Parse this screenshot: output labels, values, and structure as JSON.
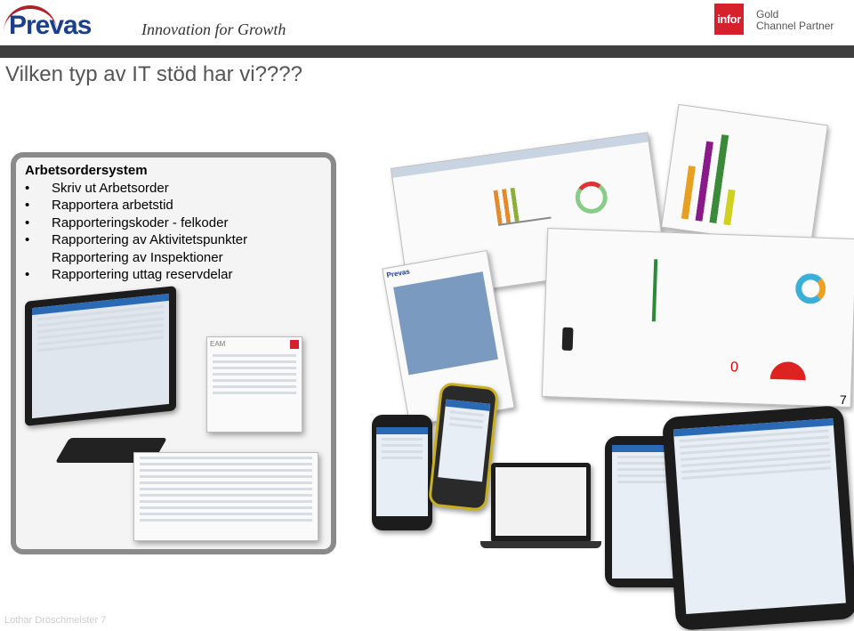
{
  "header": {
    "brand": "Prevas",
    "tagline": "Innovation for Growth",
    "partner_logo": "infor",
    "partner_line1": "Gold",
    "partner_line2": "Channel Partner"
  },
  "slide": {
    "title": "Vilken typ av IT stöd har vi????",
    "page_number": "7",
    "footer": "Lothar Dröschmeister 7"
  },
  "box": {
    "heading": "Arbetsordersystem",
    "items": [
      {
        "text": "Skriv ut Arbetsorder",
        "bullet": true
      },
      {
        "text": "Rapportera arbetstid",
        "bullet": true
      },
      {
        "text": "Rapporteringskoder - felkoder",
        "bullet": true
      },
      {
        "text": "Rapportering av Aktivitetspunkter",
        "bullet": true
      },
      {
        "text": "Rapportering av Inspektioner",
        "bullet": false
      },
      {
        "text": "Rapportering uttag reservdelar",
        "bullet": true
      }
    ]
  },
  "colors": {
    "brand_blue": "#1b3f8b",
    "infor_red": "#d6202b",
    "bar": "#3f3f3f"
  }
}
